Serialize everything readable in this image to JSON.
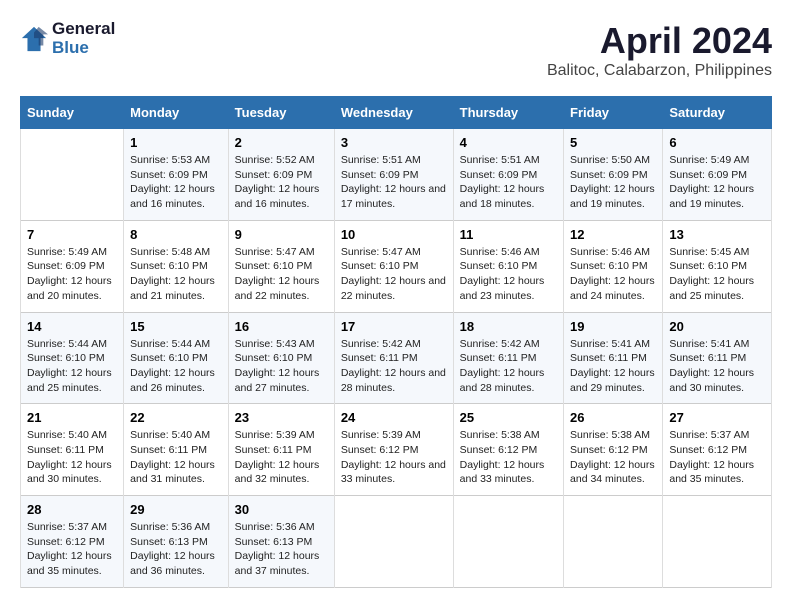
{
  "logo": {
    "line1": "General",
    "line2": "Blue"
  },
  "title": "April 2024",
  "subtitle": "Balitoc, Calabarzon, Philippines",
  "days_header": [
    "Sunday",
    "Monday",
    "Tuesday",
    "Wednesday",
    "Thursday",
    "Friday",
    "Saturday"
  ],
  "weeks": [
    [
      {
        "day": "",
        "sunrise": "",
        "sunset": "",
        "daylight": ""
      },
      {
        "day": "1",
        "sunrise": "Sunrise: 5:53 AM",
        "sunset": "Sunset: 6:09 PM",
        "daylight": "Daylight: 12 hours and 16 minutes."
      },
      {
        "day": "2",
        "sunrise": "Sunrise: 5:52 AM",
        "sunset": "Sunset: 6:09 PM",
        "daylight": "Daylight: 12 hours and 16 minutes."
      },
      {
        "day": "3",
        "sunrise": "Sunrise: 5:51 AM",
        "sunset": "Sunset: 6:09 PM",
        "daylight": "Daylight: 12 hours and 17 minutes."
      },
      {
        "day": "4",
        "sunrise": "Sunrise: 5:51 AM",
        "sunset": "Sunset: 6:09 PM",
        "daylight": "Daylight: 12 hours and 18 minutes."
      },
      {
        "day": "5",
        "sunrise": "Sunrise: 5:50 AM",
        "sunset": "Sunset: 6:09 PM",
        "daylight": "Daylight: 12 hours and 19 minutes."
      },
      {
        "day": "6",
        "sunrise": "Sunrise: 5:49 AM",
        "sunset": "Sunset: 6:09 PM",
        "daylight": "Daylight: 12 hours and 19 minutes."
      }
    ],
    [
      {
        "day": "7",
        "sunrise": "Sunrise: 5:49 AM",
        "sunset": "Sunset: 6:09 PM",
        "daylight": "Daylight: 12 hours and 20 minutes."
      },
      {
        "day": "8",
        "sunrise": "Sunrise: 5:48 AM",
        "sunset": "Sunset: 6:10 PM",
        "daylight": "Daylight: 12 hours and 21 minutes."
      },
      {
        "day": "9",
        "sunrise": "Sunrise: 5:47 AM",
        "sunset": "Sunset: 6:10 PM",
        "daylight": "Daylight: 12 hours and 22 minutes."
      },
      {
        "day": "10",
        "sunrise": "Sunrise: 5:47 AM",
        "sunset": "Sunset: 6:10 PM",
        "daylight": "Daylight: 12 hours and 22 minutes."
      },
      {
        "day": "11",
        "sunrise": "Sunrise: 5:46 AM",
        "sunset": "Sunset: 6:10 PM",
        "daylight": "Daylight: 12 hours and 23 minutes."
      },
      {
        "day": "12",
        "sunrise": "Sunrise: 5:46 AM",
        "sunset": "Sunset: 6:10 PM",
        "daylight": "Daylight: 12 hours and 24 minutes."
      },
      {
        "day": "13",
        "sunrise": "Sunrise: 5:45 AM",
        "sunset": "Sunset: 6:10 PM",
        "daylight": "Daylight: 12 hours and 25 minutes."
      }
    ],
    [
      {
        "day": "14",
        "sunrise": "Sunrise: 5:44 AM",
        "sunset": "Sunset: 6:10 PM",
        "daylight": "Daylight: 12 hours and 25 minutes."
      },
      {
        "day": "15",
        "sunrise": "Sunrise: 5:44 AM",
        "sunset": "Sunset: 6:10 PM",
        "daylight": "Daylight: 12 hours and 26 minutes."
      },
      {
        "day": "16",
        "sunrise": "Sunrise: 5:43 AM",
        "sunset": "Sunset: 6:10 PM",
        "daylight": "Daylight: 12 hours and 27 minutes."
      },
      {
        "day": "17",
        "sunrise": "Sunrise: 5:42 AM",
        "sunset": "Sunset: 6:11 PM",
        "daylight": "Daylight: 12 hours and 28 minutes."
      },
      {
        "day": "18",
        "sunrise": "Sunrise: 5:42 AM",
        "sunset": "Sunset: 6:11 PM",
        "daylight": "Daylight: 12 hours and 28 minutes."
      },
      {
        "day": "19",
        "sunrise": "Sunrise: 5:41 AM",
        "sunset": "Sunset: 6:11 PM",
        "daylight": "Daylight: 12 hours and 29 minutes."
      },
      {
        "day": "20",
        "sunrise": "Sunrise: 5:41 AM",
        "sunset": "Sunset: 6:11 PM",
        "daylight": "Daylight: 12 hours and 30 minutes."
      }
    ],
    [
      {
        "day": "21",
        "sunrise": "Sunrise: 5:40 AM",
        "sunset": "Sunset: 6:11 PM",
        "daylight": "Daylight: 12 hours and 30 minutes."
      },
      {
        "day": "22",
        "sunrise": "Sunrise: 5:40 AM",
        "sunset": "Sunset: 6:11 PM",
        "daylight": "Daylight: 12 hours and 31 minutes."
      },
      {
        "day": "23",
        "sunrise": "Sunrise: 5:39 AM",
        "sunset": "Sunset: 6:11 PM",
        "daylight": "Daylight: 12 hours and 32 minutes."
      },
      {
        "day": "24",
        "sunrise": "Sunrise: 5:39 AM",
        "sunset": "Sunset: 6:12 PM",
        "daylight": "Daylight: 12 hours and 33 minutes."
      },
      {
        "day": "25",
        "sunrise": "Sunrise: 5:38 AM",
        "sunset": "Sunset: 6:12 PM",
        "daylight": "Daylight: 12 hours and 33 minutes."
      },
      {
        "day": "26",
        "sunrise": "Sunrise: 5:38 AM",
        "sunset": "Sunset: 6:12 PM",
        "daylight": "Daylight: 12 hours and 34 minutes."
      },
      {
        "day": "27",
        "sunrise": "Sunrise: 5:37 AM",
        "sunset": "Sunset: 6:12 PM",
        "daylight": "Daylight: 12 hours and 35 minutes."
      }
    ],
    [
      {
        "day": "28",
        "sunrise": "Sunrise: 5:37 AM",
        "sunset": "Sunset: 6:12 PM",
        "daylight": "Daylight: 12 hours and 35 minutes."
      },
      {
        "day": "29",
        "sunrise": "Sunrise: 5:36 AM",
        "sunset": "Sunset: 6:13 PM",
        "daylight": "Daylight: 12 hours and 36 minutes."
      },
      {
        "day": "30",
        "sunrise": "Sunrise: 5:36 AM",
        "sunset": "Sunset: 6:13 PM",
        "daylight": "Daylight: 12 hours and 37 minutes."
      },
      {
        "day": "",
        "sunrise": "",
        "sunset": "",
        "daylight": ""
      },
      {
        "day": "",
        "sunrise": "",
        "sunset": "",
        "daylight": ""
      },
      {
        "day": "",
        "sunrise": "",
        "sunset": "",
        "daylight": ""
      },
      {
        "day": "",
        "sunrise": "",
        "sunset": "",
        "daylight": ""
      }
    ]
  ]
}
